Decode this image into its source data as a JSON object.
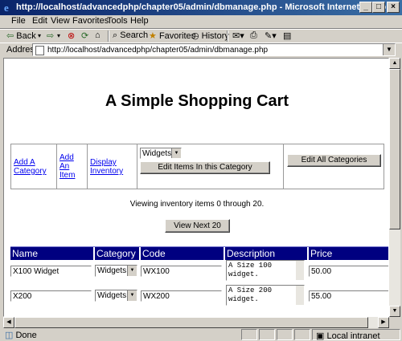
{
  "window": {
    "title": "http://localhost/advancedphp/chapter05/admin/dbmanage.php - Microsoft Internet Explorer",
    "controls": [
      "_",
      "□",
      "×"
    ]
  },
  "menu": [
    "File",
    "Edit",
    "View",
    "Favorites",
    "Tools",
    "Help"
  ],
  "toolbar": {
    "back": "Back",
    "search": "Search",
    "favorites": "Favorites",
    "history": "History"
  },
  "address": {
    "label": "Address",
    "url": "http://localhost/advancedphp/chapter05/admin/dbmanage.php"
  },
  "page": {
    "heading": "A Simple Shopping Cart",
    "nav": {
      "add_category": [
        "Add A",
        "Category"
      ],
      "add_item": [
        "Add",
        "An",
        "Item"
      ],
      "display_inventory": [
        "Display",
        "Inventory"
      ],
      "category_select": "Widgets",
      "edit_items_button": "Edit Items In this Category",
      "edit_all_button": "Edit All Categories"
    },
    "viewing_text": "Viewing inventory items 0 through 20.",
    "view_next_button": "View Next 20",
    "table": {
      "headers": [
        "Name",
        "Category",
        "Code",
        "Description",
        "Price"
      ],
      "rows": [
        {
          "name": "X100 Widget",
          "category": "Widgets",
          "code": "WX100",
          "description": [
            "A Size 100",
            "widget."
          ],
          "price": "50.00"
        },
        {
          "name": "X200",
          "category": "Widgets",
          "code": "WX200",
          "description": [
            "A Size 200",
            "widget."
          ],
          "price": "55.00"
        }
      ]
    }
  },
  "status": {
    "left": "Done",
    "zone": "Local intranet"
  },
  "colors": {
    "titlebar": "#0a246a",
    "table_header": "#000080",
    "link": "#0000ee"
  }
}
